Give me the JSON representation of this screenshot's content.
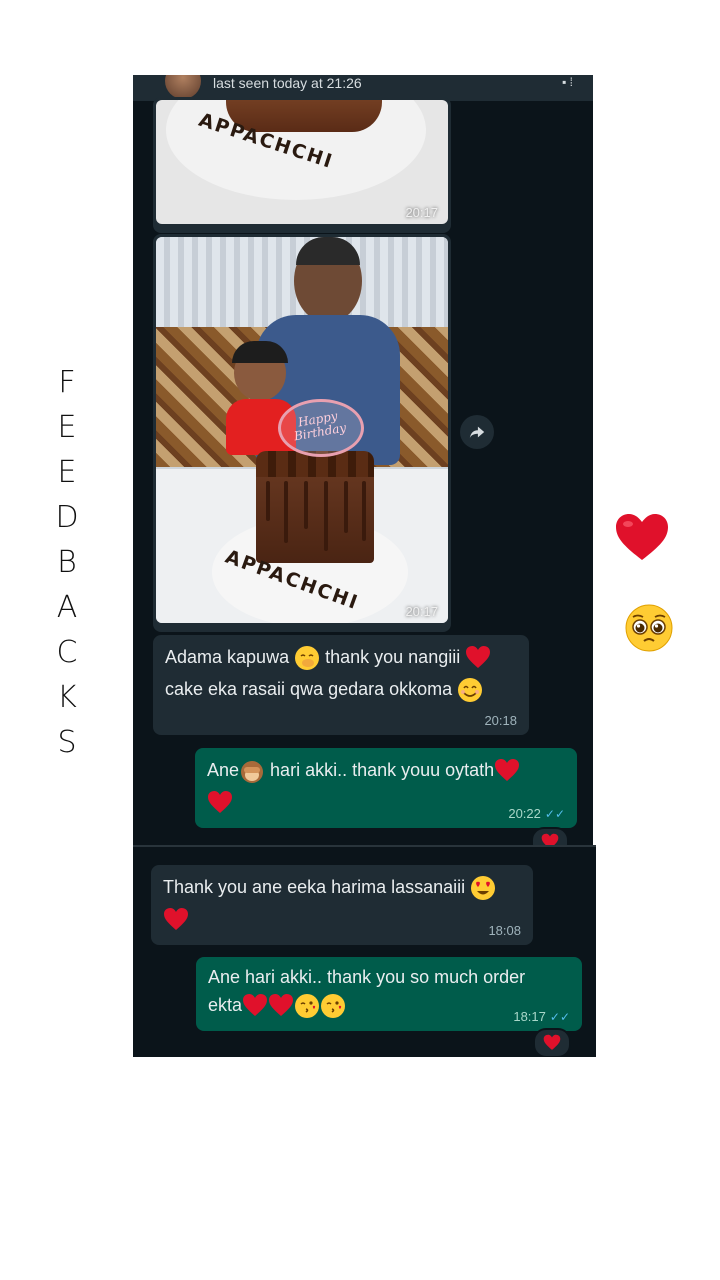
{
  "side_title": [
    "F",
    "E",
    "E",
    "D",
    "B",
    "A",
    "C",
    "K",
    "S"
  ],
  "chat1": {
    "last_seen": "last seen today at 21:26",
    "image1": {
      "plate_text": "APPACHCHI",
      "time": "20:17"
    },
    "image2": {
      "plate_text": "APPACHCHI",
      "topper_text": "Happy Birthday",
      "time": "20:17"
    },
    "msg1": {
      "line1": "Adama kapuwa",
      "line1b": "thank you nangiii",
      "line2": "cake eka rasaii qwa gedara okkoma",
      "time": "20:18"
    },
    "msg2": {
      "line1a": "Ane",
      "line1b": "hari akki.. thank youu oytath",
      "time": "20:22"
    }
  },
  "chat2": {
    "msg1": {
      "line1": "Thank you ane eeka harima lassanaiii",
      "time": "18:08"
    },
    "msg2": {
      "line1": "Ane hari akki.. thank you so much order",
      "line2": "ekta",
      "time": "18:17"
    }
  },
  "icons": {
    "heart": "heart-icon",
    "pleading": "pleading-face-icon",
    "forward": "forward-icon",
    "read_ticks": "double-check-icon"
  },
  "colors": {
    "chat_bg": "#0b141a",
    "incoming": "#1f2c34",
    "outgoing": "#005c4b",
    "tick_blue": "#53bdeb"
  }
}
